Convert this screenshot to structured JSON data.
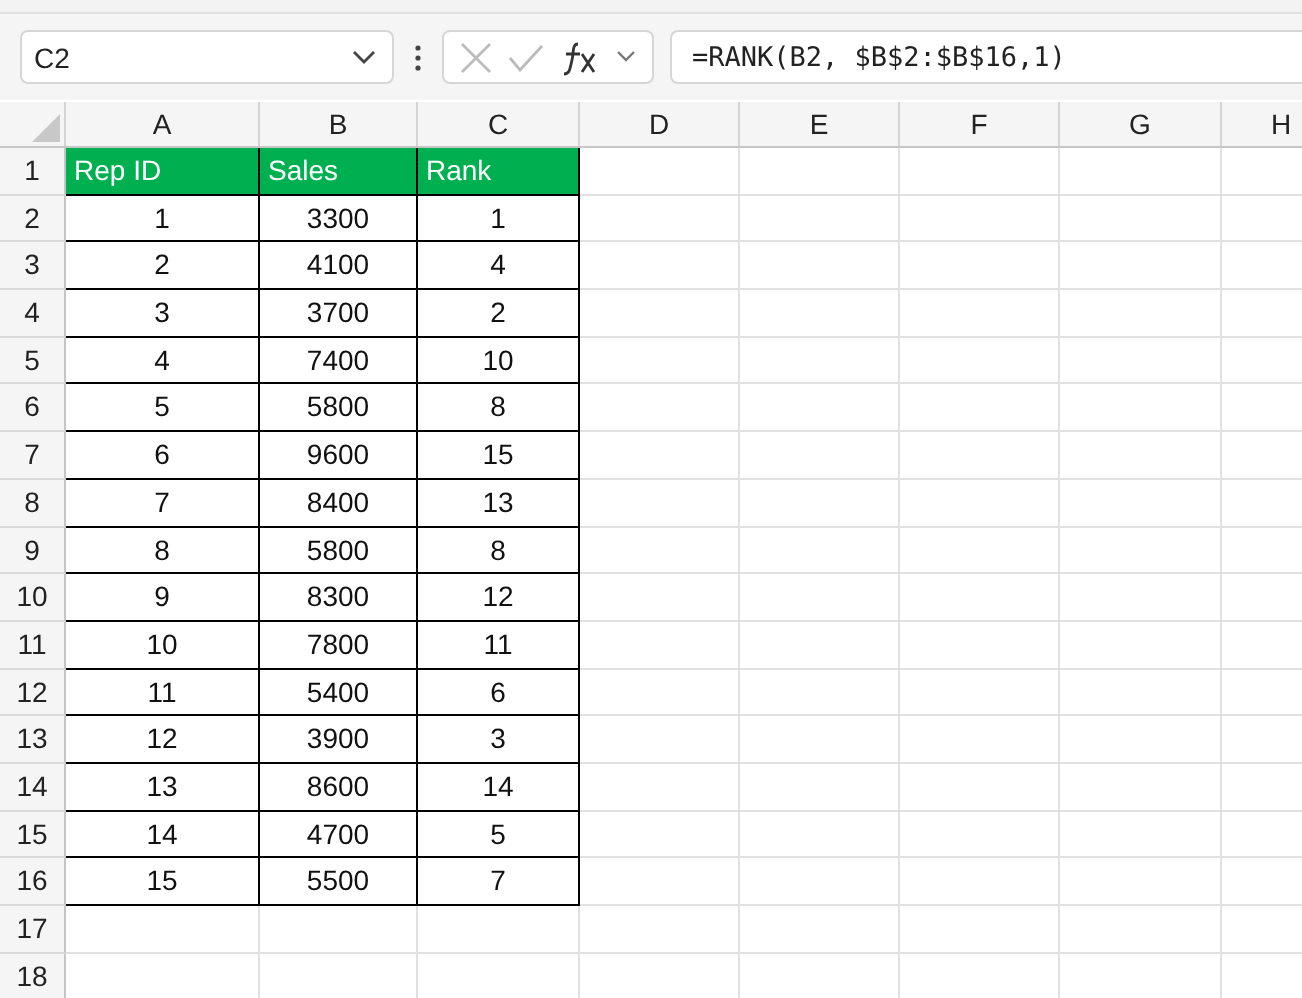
{
  "name_box": {
    "value": "C2"
  },
  "formula_bar": {
    "value": "=RANK(B2, $B$2:$B$16,1)"
  },
  "columns": [
    "A",
    "B",
    "C",
    "D",
    "E",
    "F",
    "G",
    "H"
  ],
  "rows": [
    {
      "number": "1",
      "kind": "header",
      "cells": [
        "Rep ID",
        "Sales",
        "Rank"
      ]
    },
    {
      "number": "2",
      "kind": "data",
      "cells": [
        "1",
        "3300",
        "1"
      ]
    },
    {
      "number": "3",
      "kind": "data",
      "cells": [
        "2",
        "4100",
        "4"
      ]
    },
    {
      "number": "4",
      "kind": "data",
      "cells": [
        "3",
        "3700",
        "2"
      ]
    },
    {
      "number": "5",
      "kind": "data",
      "cells": [
        "4",
        "7400",
        "10"
      ]
    },
    {
      "number": "6",
      "kind": "data",
      "cells": [
        "5",
        "5800",
        "8"
      ]
    },
    {
      "number": "7",
      "kind": "data",
      "cells": [
        "6",
        "9600",
        "15"
      ]
    },
    {
      "number": "8",
      "kind": "data",
      "cells": [
        "7",
        "8400",
        "13"
      ]
    },
    {
      "number": "9",
      "kind": "data",
      "cells": [
        "8",
        "5800",
        "8"
      ]
    },
    {
      "number": "10",
      "kind": "data",
      "cells": [
        "9",
        "8300",
        "12"
      ]
    },
    {
      "number": "11",
      "kind": "data",
      "cells": [
        "10",
        "7800",
        "11"
      ]
    },
    {
      "number": "12",
      "kind": "data",
      "cells": [
        "11",
        "5400",
        "6"
      ]
    },
    {
      "number": "13",
      "kind": "data",
      "cells": [
        "12",
        "3900",
        "3"
      ]
    },
    {
      "number": "14",
      "kind": "data",
      "cells": [
        "13",
        "8600",
        "14"
      ]
    },
    {
      "number": "15",
      "kind": "data",
      "cells": [
        "14",
        "4700",
        "5"
      ]
    },
    {
      "number": "16",
      "kind": "data",
      "cells": [
        "15",
        "5500",
        "7"
      ]
    },
    {
      "number": "17",
      "cells": []
    },
    {
      "number": "18",
      "cells": []
    }
  ]
}
